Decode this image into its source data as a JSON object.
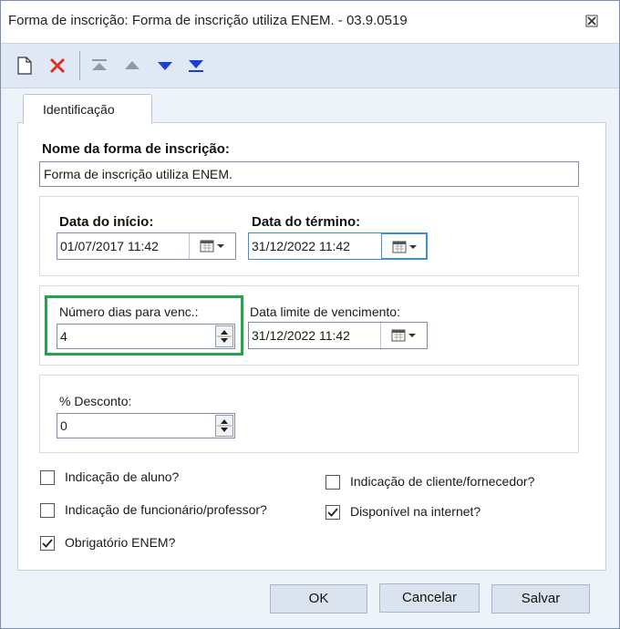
{
  "window": {
    "title": "Forma de inscrição: Forma de inscrição utiliza ENEM. - 03.9.0519",
    "close_icon": "close-icon"
  },
  "toolbar": {
    "icons": [
      "new-document-icon",
      "delete-icon",
      "move-first-icon",
      "move-up-icon",
      "move-down-icon",
      "move-last-icon"
    ]
  },
  "tabs": [
    {
      "label": "Identificação"
    }
  ],
  "form": {
    "nome_label": "Nome da forma de inscrição:",
    "nome_value": "Forma de inscrição utiliza ENEM.",
    "data_inicio_label": "Data do início:",
    "data_inicio_value": "01/07/2017 11:42",
    "data_termino_label": "Data do término:",
    "data_termino_value": "31/12/2022 11:42",
    "num_dias_label": "Número dias para venc.:",
    "num_dias_value": "4",
    "data_limite_label": "Data limite de vencimento:",
    "data_limite_value": "31/12/2022 11:42",
    "desconto_label": "% Desconto:",
    "desconto_value": "0"
  },
  "checkboxes": [
    {
      "label": "Indicação de aluno?",
      "checked": false
    },
    {
      "label": "Indicação de funcionário/professor?",
      "checked": false
    },
    {
      "label": "Obrigatório ENEM?",
      "checked": true
    },
    {
      "label": "Indicação de cliente/fornecedor?",
      "checked": false
    },
    {
      "label": "Disponível na internet?",
      "checked": true
    }
  ],
  "buttons": {
    "ok": "OK",
    "cancelar": "Cancelar",
    "salvar": "Salvar"
  },
  "colors": {
    "highlight": "#22a24a",
    "delete": "#e03020",
    "arrow_blue": "#1a3fcf"
  }
}
